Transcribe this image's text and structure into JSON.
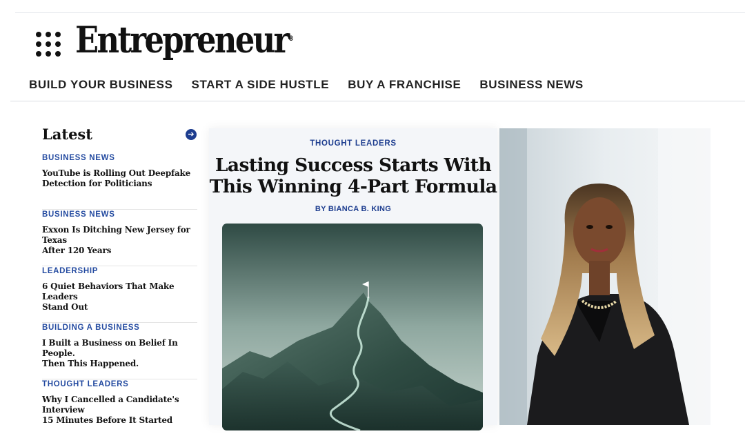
{
  "header": {
    "logo_text": "Entrepreneur",
    "logo_mark": "®",
    "menu_icon": "grid-dots-icon",
    "nav": [
      "BUILD YOUR BUSINESS",
      "START A SIDE HUSTLE",
      "BUY A FRANCHISE",
      "BUSINESS NEWS"
    ]
  },
  "latest": {
    "title": "Latest",
    "arrow_icon": "arrow-right-circle-icon",
    "items": [
      {
        "category": "BUSINESS NEWS",
        "title_line1": "YouTube is Rolling Out Deepfake",
        "title_line2": "Detection for Politicians"
      },
      {
        "category": "BUSINESS NEWS",
        "title_line1": "Exxon Is Ditching New Jersey for Texas",
        "title_line2": "After 120 Years"
      },
      {
        "category": "LEADERSHIP",
        "title_line1": "6 Quiet Behaviors That Make Leaders",
        "title_line2": "Stand Out"
      },
      {
        "category": "BUILDING A BUSINESS",
        "title_line1": "I Built a Business on Belief In People.",
        "title_line2": "Then This Happened."
      },
      {
        "category": "THOUGHT LEADERS",
        "title_line1": "Why I Cancelled a Candidate's Interview",
        "title_line2": "15 Minutes Before It Started"
      }
    ]
  },
  "feature": {
    "category": "THOUGHT LEADERS",
    "title_line1": "Lasting Success Starts With",
    "title_line2": "This Winning 4-Part Formula",
    "byline": "BY BIANCA B. KING"
  },
  "colors": {
    "accent": "#1d3d8f",
    "category": "#234aa0"
  }
}
